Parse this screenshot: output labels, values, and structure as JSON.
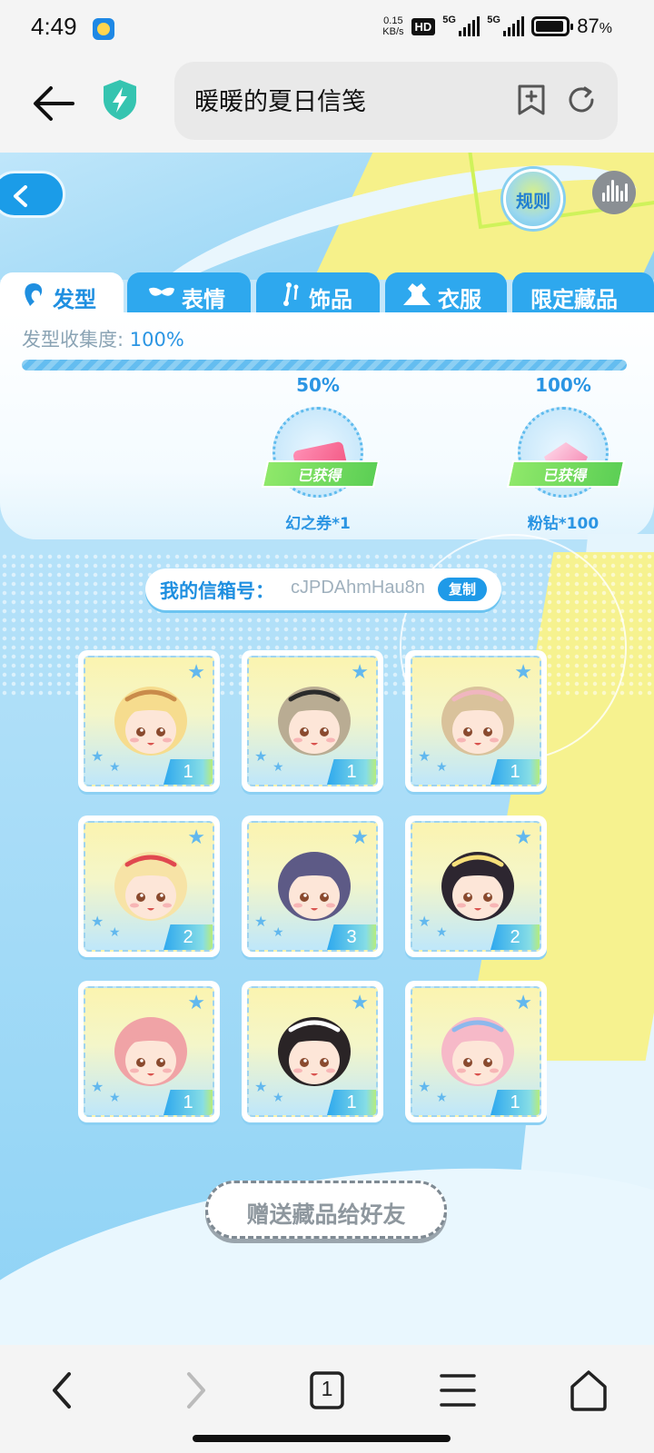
{
  "status_bar": {
    "time": "4:49",
    "net_speed_value": "0.15",
    "net_speed_unit": "KB/s",
    "hd_badge": "HD",
    "signal_1_label": "5G",
    "signal_2_label": "5G",
    "battery_percent": "87",
    "battery_suffix": "%"
  },
  "browser": {
    "page_title": "暖暖的夏日信笺",
    "icons": [
      "back-arrow-icon",
      "shield-bolt-icon",
      "bookmark-add-icon",
      "reload-icon"
    ]
  },
  "game": {
    "rules_label": "规则",
    "tabs": [
      {
        "label": "发型",
        "icon": "hair-icon",
        "active": true
      },
      {
        "label": "表情",
        "icon": "mask-icon",
        "active": false
      },
      {
        "label": "饰品",
        "icon": "earring-icon",
        "active": false
      },
      {
        "label": "衣服",
        "icon": "clothes-icon",
        "active": false
      },
      {
        "label": "限定藏品",
        "icon": "",
        "active": false
      }
    ],
    "progress": {
      "label": "发型收集度: ",
      "value_text": "100%",
      "fraction": 1.0
    },
    "rewards": [
      {
        "threshold": "50%",
        "status": "已获得",
        "name": "幻之券*1",
        "icon": "ticket-icon"
      },
      {
        "threshold": "100%",
        "status": "已获得",
        "name": "粉钻*100",
        "icon": "pink-diamond-icon"
      }
    ],
    "mailbox": {
      "label": "我的信箱号：",
      "code": "cJPDAhmHau8n",
      "copy_label": "复制"
    },
    "hair_items": [
      {
        "count": "1",
        "hair": "#f6dc8e",
        "accent": "#c98b4a"
      },
      {
        "count": "1",
        "hair": "#b9ac93",
        "accent": "#2b2b2b"
      },
      {
        "count": "1",
        "hair": "#d9c29b",
        "accent": "#f0b6bf"
      },
      {
        "count": "2",
        "hair": "#f7e3a6",
        "accent": "#e0484f"
      },
      {
        "count": "3",
        "hair": "#5d5a86",
        "accent": "#5d5a86"
      },
      {
        "count": "2",
        "hair": "#2d2630",
        "accent": "#f7e07a"
      },
      {
        "count": "1",
        "hair": "#f0a3a6",
        "accent": "#f0a3a6"
      },
      {
        "count": "1",
        "hair": "#2a2426",
        "accent": "#ffffff"
      },
      {
        "count": "1",
        "hair": "#f6b9c8",
        "accent": "#8db8ec"
      }
    ],
    "gift_button": "赠送藏品给好友"
  },
  "nav": {
    "tab_count": "1",
    "icons": [
      "back-icon",
      "forward-icon",
      "tabs-icon",
      "menu-icon",
      "home-icon"
    ]
  }
}
